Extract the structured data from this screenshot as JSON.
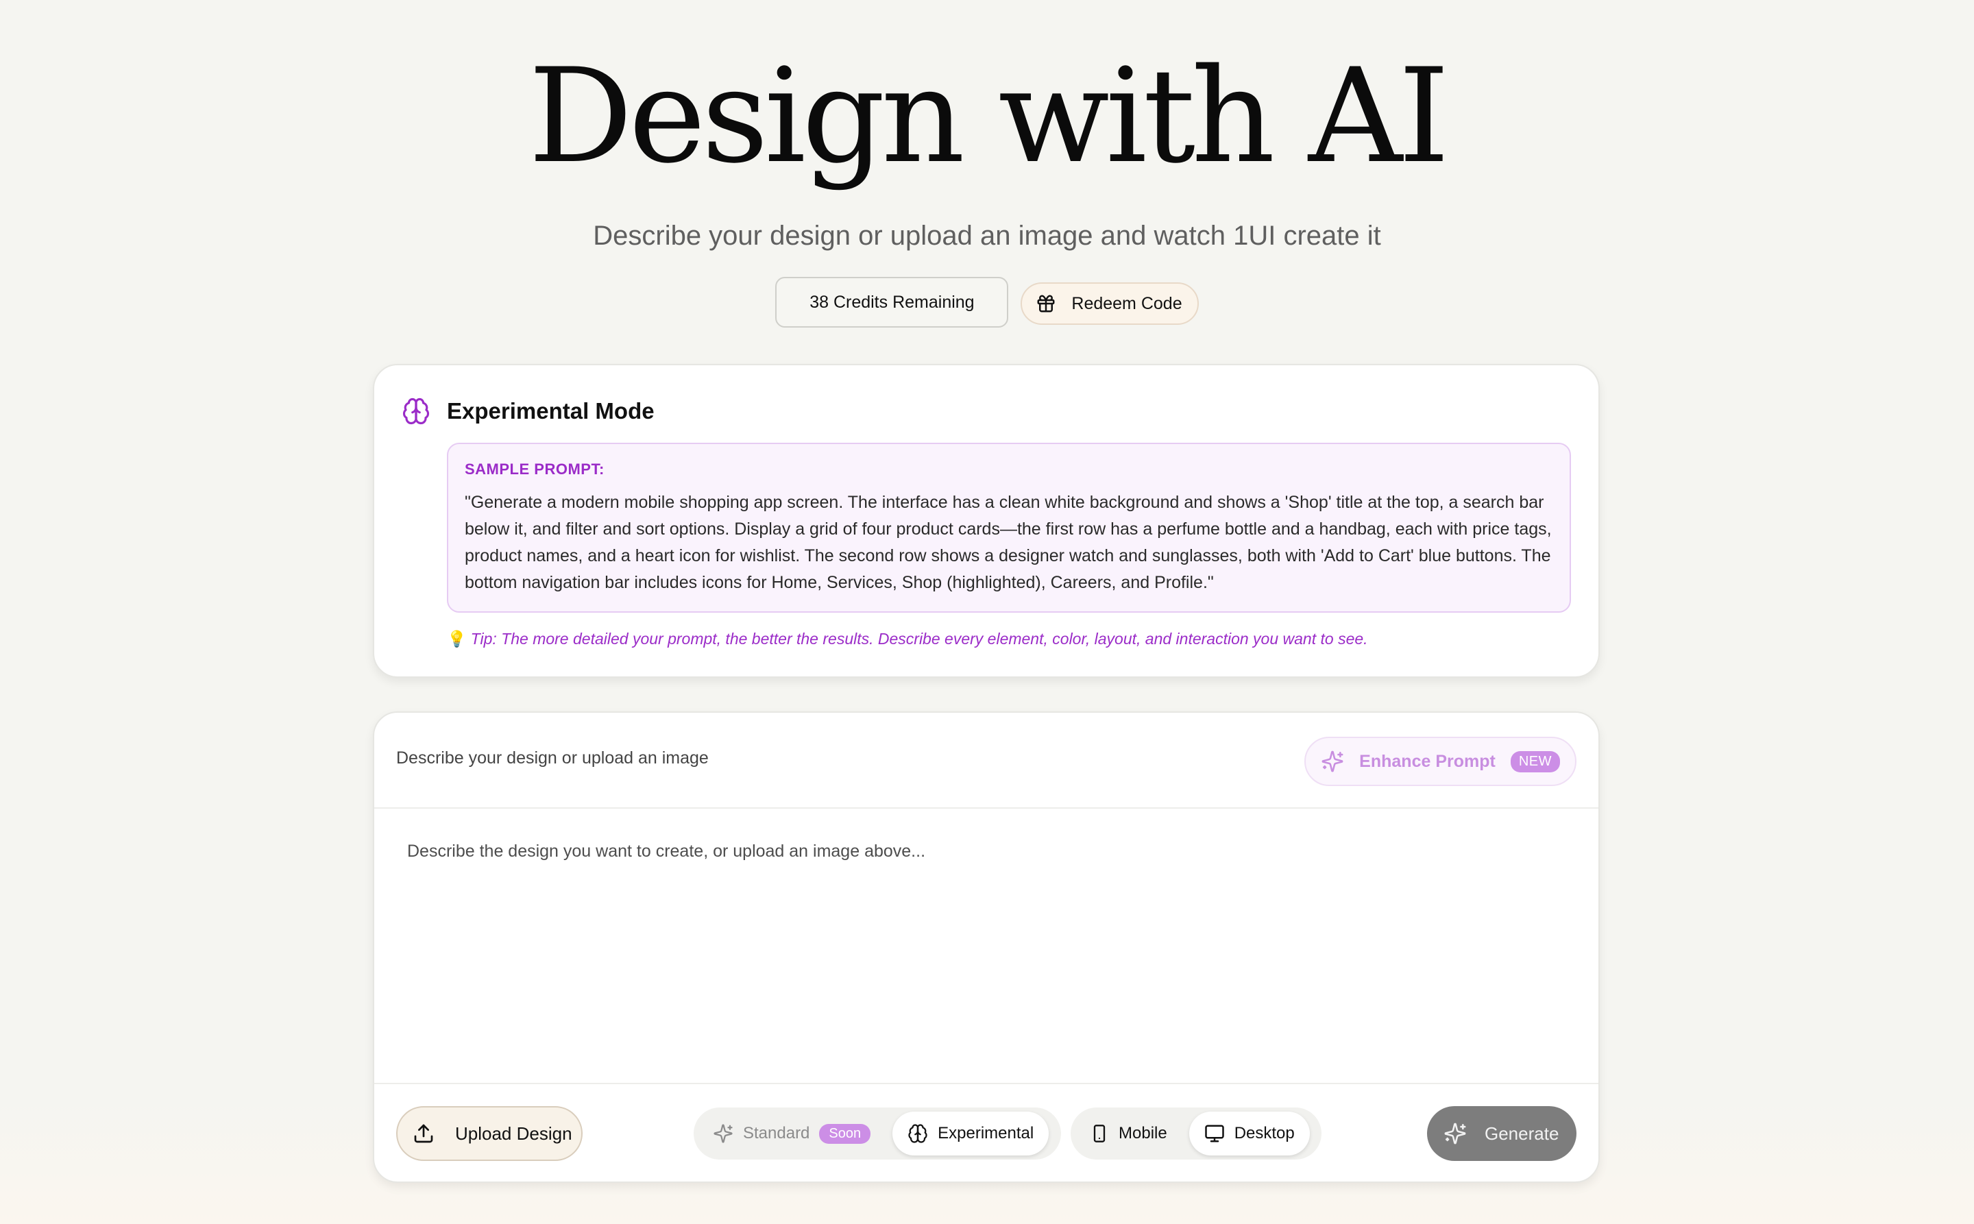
{
  "hero": {
    "title": "Design with AI",
    "subtitle": "Describe your design or upload an image and watch 1UI create it"
  },
  "credits": {
    "label": "38 Credits Remaining",
    "redeem_label": "Redeem Code"
  },
  "experimental": {
    "title": "Experimental Mode",
    "sample_label": "SAMPLE PROMPT:",
    "sample_text": "\"Generate a modern mobile shopping app screen. The interface has a clean white background and shows a 'Shop' title at the top, a search bar below it, and filter and sort options. Display a grid of four product cards—the first row has a perfume bottle and a handbag, each with price tags, product names, and a heart icon for wishlist. The second row shows a designer watch and sunglasses, both with 'Add to Cart' blue buttons. The bottom navigation bar includes icons for Home, Services, Shop (highlighted), Careers, and Profile.\"",
    "tip_icon": "💡",
    "tip": "Tip: The more detailed your prompt, the better the results. Describe every element, color, layout, and interaction you want to see."
  },
  "composer": {
    "label": "Describe your design or upload an image",
    "enhance_label": "Enhance Prompt",
    "enhance_badge": "NEW",
    "placeholder": "Describe the design you want to create, or upload an image above...",
    "upload_label": "Upload Design",
    "modes": {
      "standard": "Standard",
      "standard_badge": "Soon",
      "experimental": "Experimental",
      "selected": "Experimental"
    },
    "views": {
      "mobile": "Mobile",
      "desktop": "Desktop",
      "selected": "Desktop"
    },
    "generate_label": "Generate"
  },
  "colors": {
    "accent_purple": "#9b2cc8",
    "badge_purple": "#cc8ee6",
    "page_bg": "#f5f5f1",
    "generate_bg": "#7d7d7d"
  },
  "icons": {
    "experimental": "brain-icon",
    "redeem": "gift-icon",
    "enhance": "sparkles-icon",
    "upload": "upload-icon",
    "mobile": "smartphone-icon",
    "desktop": "monitor-icon",
    "generate": "sparkles-icon"
  }
}
